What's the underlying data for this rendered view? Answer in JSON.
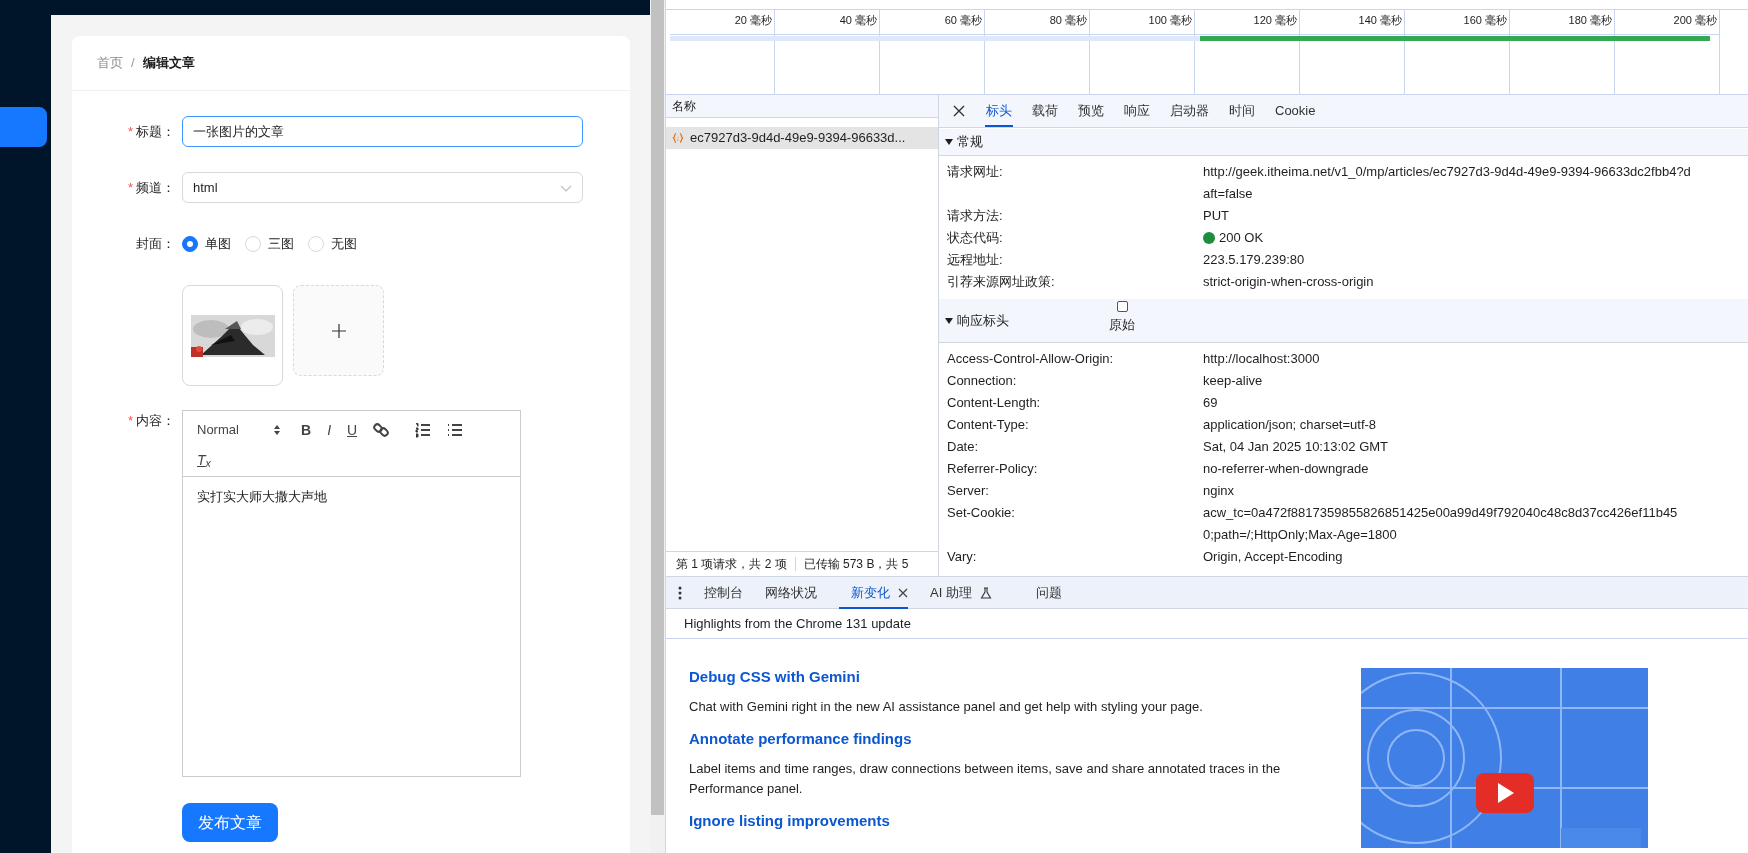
{
  "app": {
    "sidebar": {
      "items": [
        {
          "selected": true
        }
      ]
    },
    "breadcrumb": [
      {
        "label": "首页"
      },
      {
        "label": "编辑文章"
      }
    ],
    "breadcrumb_separator": "/",
    "form": {
      "title": {
        "label": "标题：",
        "required_mark": "*",
        "value": "一张图片的文章",
        "focused": true
      },
      "channel": {
        "label": "频道：",
        "required_mark": "*",
        "value": "html"
      },
      "cover": {
        "label": "封面：",
        "options": [
          {
            "label": "单图",
            "selected": true
          },
          {
            "label": "三图",
            "selected": false
          },
          {
            "label": "无图",
            "selected": false
          }
        ],
        "uploads": [
          {
            "kind": "picture"
          },
          {
            "kind": "add"
          }
        ]
      },
      "content": {
        "label": "内容：",
        "required_mark": "*",
        "toolbar": [
          {
            "kind": "header",
            "label": "Normal"
          },
          {
            "kind": "bold",
            "label": "B"
          },
          {
            "kind": "italic",
            "label": "I"
          },
          {
            "kind": "underline",
            "label": "U"
          },
          {
            "kind": "link"
          },
          {
            "kind": "ordered"
          },
          {
            "kind": "bullet"
          },
          {
            "kind": "clean",
            "label": "T$_{x}$"
          }
        ],
        "text": "实打实大师大撒大声地"
      },
      "submit": "发布文章"
    }
  },
  "devtools": {
    "timeline": {
      "ticks": [
        "20 毫秒",
        "40 毫秒",
        "60 毫秒",
        "80 毫秒",
        "100 毫秒",
        "120 毫秒",
        "140 毫秒",
        "160 毫秒",
        "180 毫秒",
        "200 毫秒"
      ]
    },
    "requests": {
      "column": "名称",
      "rows": [
        {
          "name": "ec7927d3-9d4d-49e9-9394-96633d...",
          "selected": true
        }
      ],
      "summary": "第 1 项请求，共 2 项",
      "transferred": "已传输 573 B，共 5"
    },
    "detail": {
      "tabs": [
        {
          "label": "标头",
          "selected": true
        },
        {
          "label": "载荷",
          "selected": false
        },
        {
          "label": "预览",
          "selected": false
        },
        {
          "label": "响应",
          "selected": false
        },
        {
          "label": "启动器",
          "selected": false
        },
        {
          "label": "时间",
          "selected": false
        },
        {
          "label": "Cookie",
          "selected": false
        }
      ],
      "general": {
        "title": "常规",
        "expanded": true,
        "rows": [
          {
            "name": "请求网址:",
            "value": "http://geek.itheima.net/v1_0/mp/articles/ec7927d3-9d4d-49e9-9394-96633dc2fbb4?d",
            "more": "aft=false"
          },
          {
            "name": "请求方法:",
            "value": "PUT"
          },
          {
            "name": "状态代码:",
            "value": "200 OK",
            "kind": "status"
          },
          {
            "name": "远程地址:",
            "value": "223.5.179.239:80"
          },
          {
            "name": "引荐来源网址政策:",
            "value": "strict-origin-when-cross-origin"
          }
        ]
      },
      "response_headers": {
        "title": "响应标头",
        "expanded": true,
        "raw": {
          "label": "原始",
          "checked": false
        },
        "rows": [
          {
            "name": "Access-Control-Allow-Origin:",
            "value": "http://localhost:3000"
          },
          {
            "name": "Connection:",
            "value": "keep-alive"
          },
          {
            "name": "Content-Length:",
            "value": "69"
          },
          {
            "name": "Content-Type:",
            "value": "application/json; charset=utf-8"
          },
          {
            "name": "Date:",
            "value": "Sat, 04 Jan 2025 10:13:02 GMT"
          },
          {
            "name": "Referrer-Policy:",
            "value": "no-referrer-when-downgrade"
          },
          {
            "name": "Server:",
            "value": "nginx"
          },
          {
            "name": "Set-Cookie:",
            "value": "acw_tc=0a472f8817359855826851425e00a99d49f792040c48c8d37cc426ef11b45",
            "more": "0;path=/;HttpOnly;Max-Age=1800"
          },
          {
            "name": "Vary:",
            "value": "Origin, Accept-Encoding"
          }
        ]
      }
    },
    "drawer": {
      "tabs": [
        {
          "label": "控制台",
          "selected": false
        },
        {
          "label": "网络状况",
          "selected": false
        },
        {
          "label": "新变化",
          "selected": true,
          "closable": true
        },
        {
          "label": "AI 助理",
          "selected": false,
          "kind": "lab"
        },
        {
          "label": "问题",
          "selected": false
        }
      ],
      "heading": "Highlights from the Chrome 131 update",
      "articles": [
        {
          "title": "Debug CSS with Gemini",
          "body": "Chat with Gemini right in the new AI assistance panel and get help with styling your page."
        },
        {
          "title": "Annotate performance findings",
          "body": "Label items and time ranges, draw connections between items, save and share annotated traces in the Performance panel."
        },
        {
          "title": "Ignore listing improvements"
        }
      ],
      "media": {
        "kind": "picture"
      }
    }
  }
}
